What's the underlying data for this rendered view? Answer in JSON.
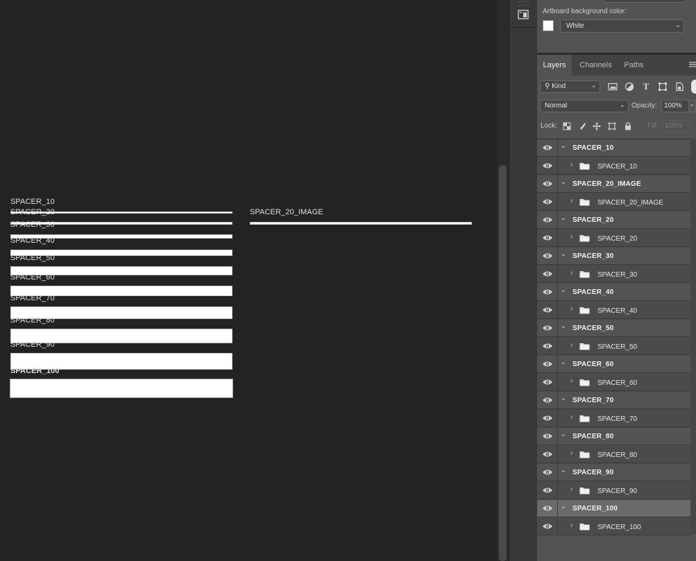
{
  "canvas": {
    "artboard_labels": [
      "SPACER_10",
      "SPACER_20",
      "SPACER_30",
      "SPACER_40",
      "SPACER_50",
      "SPACER_60",
      "SPACER_70",
      "SPACER_80",
      "SPACER_90",
      "SPACER_100"
    ],
    "image_label": "SPACER_20_IMAGE"
  },
  "properties": {
    "bg_label": "Artboard background color:",
    "bg_value": "White"
  },
  "tabs": [
    "Layers",
    "Channels",
    "Paths"
  ],
  "filter": {
    "kind_label": "Kind"
  },
  "blend": {
    "mode": "Normal",
    "opacity_label": "Opacity:",
    "opacity_value": "100%"
  },
  "lock": {
    "label": "Lock:",
    "fill_label": "Fill:",
    "fill_value": "100%"
  },
  "layers": [
    {
      "group": "SPACER_10",
      "child": "SPACER_10"
    },
    {
      "group": "SPACER_20_IMAGE",
      "child": "SPACER_20_IMAGE"
    },
    {
      "group": "SPACER_20",
      "child": "SPACER_20"
    },
    {
      "group": "SPACER_30",
      "child": "SPACER_30"
    },
    {
      "group": "SPACER_40",
      "child": "SPACER_40"
    },
    {
      "group": "SPACER_50",
      "child": "SPACER_50"
    },
    {
      "group": "SPACER_60",
      "child": "SPACER_60"
    },
    {
      "group": "SPACER_70",
      "child": "SPACER_70"
    },
    {
      "group": "SPACER_80",
      "child": "SPACER_80"
    },
    {
      "group": "SPACER_90",
      "child": "SPACER_90"
    },
    {
      "group": "SPACER_100",
      "child": "SPACER_100"
    }
  ],
  "selected_layer": "SPACER_100",
  "colors": {
    "canvas_bg": "#232323",
    "panel_bg": "#535353",
    "artboard_fill": "#ffffff"
  }
}
